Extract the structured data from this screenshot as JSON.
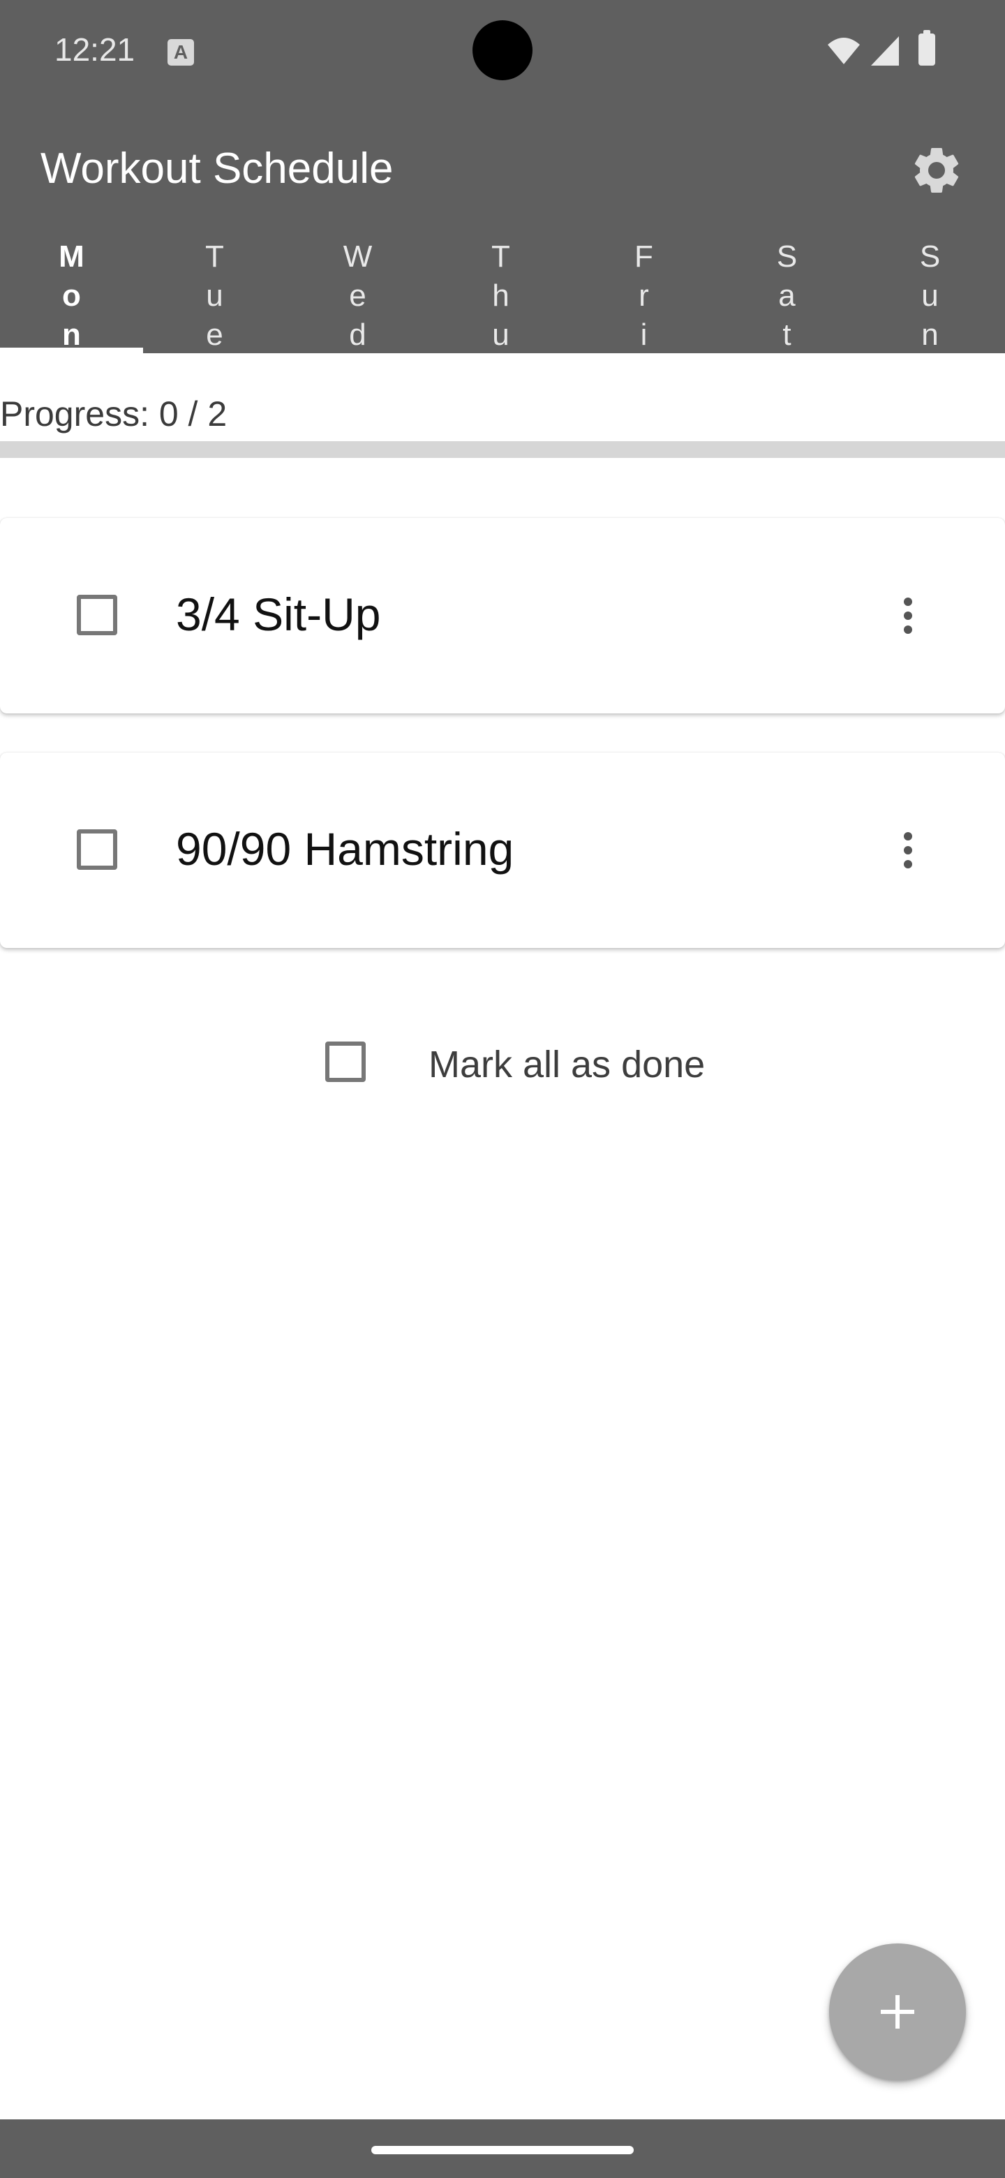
{
  "status_bar": {
    "time": "12:21",
    "notification_icon": "A"
  },
  "app": {
    "title": "Workout Schedule",
    "settings_icon": "gear-icon"
  },
  "tabs": [
    {
      "label": "Mon",
      "selected": true
    },
    {
      "label": "Tue",
      "selected": false
    },
    {
      "label": "Wed",
      "selected": false
    },
    {
      "label": "Thu",
      "selected": false
    },
    {
      "label": "Fri",
      "selected": false
    },
    {
      "label": "Sat",
      "selected": false
    },
    {
      "label": "Sun",
      "selected": false
    }
  ],
  "progress": {
    "text": "Progress: 0 / 2",
    "completed": 0,
    "total": 2,
    "fraction": 0
  },
  "exercises": [
    {
      "name": "3/4 Sit-Up",
      "checked": false
    },
    {
      "name": "90/90 Hamstring",
      "checked": false
    }
  ],
  "mark_all": {
    "label": "Mark all as done",
    "checked": false
  },
  "fab": {
    "icon": "plus-icon"
  },
  "colors": {
    "header": "#5f5f5f",
    "fab": "#a8a8a8",
    "progress_track": "#d6d6d6"
  }
}
